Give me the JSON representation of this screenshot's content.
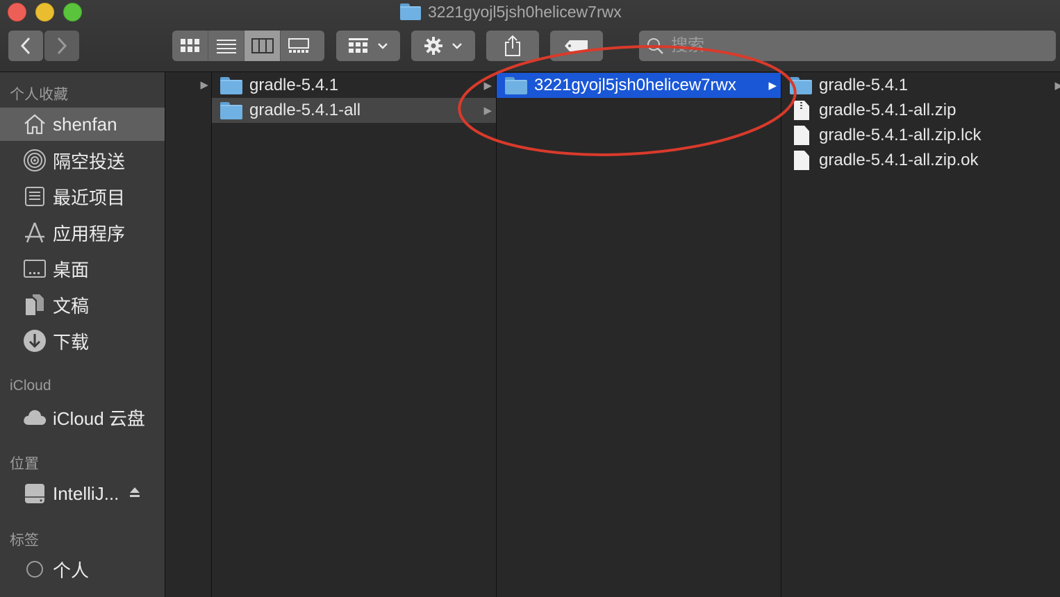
{
  "window": {
    "title": "3221gyojl5jsh0helicew7rwx"
  },
  "toolbar": {
    "back_icon": "chevron-left-icon",
    "forward_icon": "chevron-right-icon",
    "view_modes": [
      "icon-view",
      "list-view",
      "column-view",
      "gallery-view"
    ],
    "active_view": "column-view",
    "search_placeholder": "搜索"
  },
  "sidebar": {
    "favorites_header": "个人收藏",
    "favorites": [
      {
        "label": "shenfan",
        "icon": "home-icon",
        "selected": true
      },
      {
        "label": "隔空投送",
        "icon": "airdrop-icon"
      },
      {
        "label": "最近项目",
        "icon": "recents-icon"
      },
      {
        "label": "应用程序",
        "icon": "applications-icon"
      },
      {
        "label": "桌面",
        "icon": "desktop-icon"
      },
      {
        "label": "文稿",
        "icon": "documents-icon"
      },
      {
        "label": "下载",
        "icon": "download-icon"
      }
    ],
    "icloud_header": "iCloud",
    "icloud_items": [
      {
        "label": "iCloud 云盘",
        "icon": "cloud-icon"
      }
    ],
    "locations_header": "位置",
    "locations": [
      {
        "label": "IntelliJ...",
        "icon": "disk-icon",
        "eject_icon": "eject-icon"
      }
    ],
    "tags_header": "标签",
    "tags": [
      {
        "label": "个人",
        "icon": "tag-circle-icon"
      }
    ]
  },
  "columns": {
    "col2": [
      {
        "name": "gradle-5.4.1",
        "type": "folder"
      },
      {
        "name": "gradle-5.4.1-all",
        "type": "folder",
        "selected": "inactive"
      }
    ],
    "col3": [
      {
        "name": "3221gyojl5jsh0helicew7rwx",
        "type": "folder",
        "selected": "active"
      }
    ],
    "col4": [
      {
        "name": "gradle-5.4.1",
        "type": "folder"
      },
      {
        "name": "gradle-5.4.1-all.zip",
        "type": "zip"
      },
      {
        "name": "gradle-5.4.1-all.zip.lck",
        "type": "file"
      },
      {
        "name": "gradle-5.4.1-all.zip.ok",
        "type": "file"
      }
    ]
  },
  "colors": {
    "selection_blue": "#1a57d6",
    "annotation_red": "#d93a2b",
    "folder_blue": "#6fb1e2"
  },
  "annotation": {
    "shape": "ellipse",
    "target": "col3.0"
  }
}
